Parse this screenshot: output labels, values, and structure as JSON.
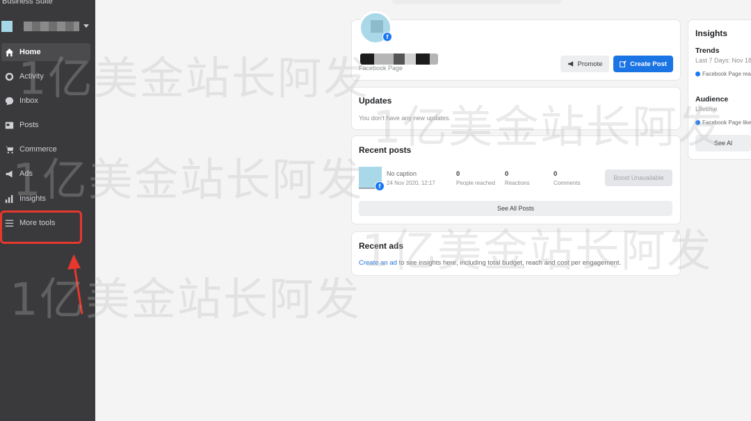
{
  "sidebar": {
    "brand": "Business Suite",
    "items": [
      {
        "label": "Home",
        "icon": "home-icon"
      },
      {
        "label": "Activity",
        "icon": "activity-icon"
      },
      {
        "label": "Inbox",
        "icon": "inbox-icon"
      },
      {
        "label": "Posts",
        "icon": "posts-icon"
      },
      {
        "label": "Commerce",
        "icon": "commerce-icon"
      },
      {
        "label": "Ads",
        "icon": "ads-icon"
      },
      {
        "label": "Insights",
        "icon": "insights-icon"
      },
      {
        "label": "More tools",
        "icon": "menu-icon"
      }
    ]
  },
  "page": {
    "subtitle": "Facebook Page",
    "promote_label": "Promote",
    "create_post_label": "Create Post"
  },
  "updates": {
    "title": "Updates",
    "empty_text": "You don't have any new updates."
  },
  "recent_posts": {
    "title": "Recent posts",
    "post": {
      "caption": "No caption",
      "date": "24 Nov 2020, 12:17",
      "metrics": [
        {
          "value": "0",
          "label": "People reached"
        },
        {
          "value": "0",
          "label": "Reactions"
        },
        {
          "value": "0",
          "label": "Comments"
        }
      ],
      "boost_label": "Boost Unavailable"
    },
    "see_all_label": "See All Posts"
  },
  "recent_ads": {
    "title": "Recent ads",
    "link_text": "Create an ad",
    "rest_text": " to see insights here, including total budget, reach and cost per engagement."
  },
  "insights": {
    "title": "Insights",
    "trends_title": "Trends",
    "trends_range": "Last 7 Days: Nov 18",
    "trends_metric": "Facebook Page rea",
    "audience_title": "Audience",
    "audience_range": "Lifetime",
    "audience_metric": "Facebook Page like",
    "see_all_label": "See Al"
  },
  "watermark": "1亿美金站长阿发",
  "colors": {
    "sidebar_bg": "#3a3a3c",
    "accent_blue": "#1b74e4",
    "highlight_red": "#e8372d",
    "background": "#f4f4f5"
  }
}
